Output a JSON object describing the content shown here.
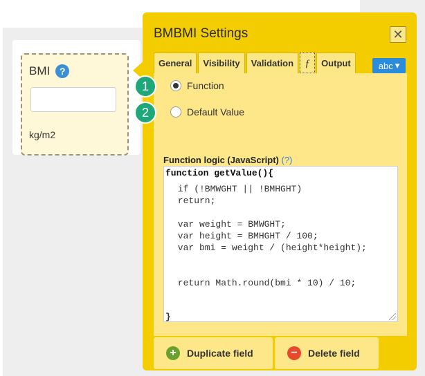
{
  "field": {
    "label": "BMI",
    "unit": "kg/m2",
    "help_icon": "?"
  },
  "panel": {
    "title": "BMBMI Settings",
    "close_glyph": "✕",
    "tabs": [
      "General",
      "Visibility",
      "Validation",
      "ƒ",
      "Output"
    ],
    "abc_label": "abc",
    "abc_caret": "▾",
    "radios": [
      {
        "badge": "1",
        "label": "Function",
        "checked": true
      },
      {
        "badge": "2",
        "label": "Default Value",
        "checked": false
      }
    ],
    "function_title": "Function logic (JavaScript)",
    "function_help": "(?)",
    "code_head": "function getValue(){",
    "code_body": " if (!BMWGHT || !BMHGHT)\n return;\n\n var weight = BMWGHT;\n var height = BMHGHT / 100;\n var bmi = weight / (height*height);\n\n\n return Math.round(bmi * 10) / 10;",
    "code_end": "}",
    "buttons": {
      "duplicate": "Duplicate field",
      "delete": "Delete field"
    }
  },
  "colors": {
    "panel_bg": "#f3cd00",
    "content_bg": "#fde788",
    "badge": "#1ea87a",
    "accent_blue": "#2a8cdb",
    "delete_red": "#e8492c",
    "add_green": "#6aa12c"
  },
  "icons": {
    "help": "help-icon",
    "close": "close-icon",
    "duplicate": "plus-circle-icon",
    "delete": "minus-circle-icon"
  }
}
